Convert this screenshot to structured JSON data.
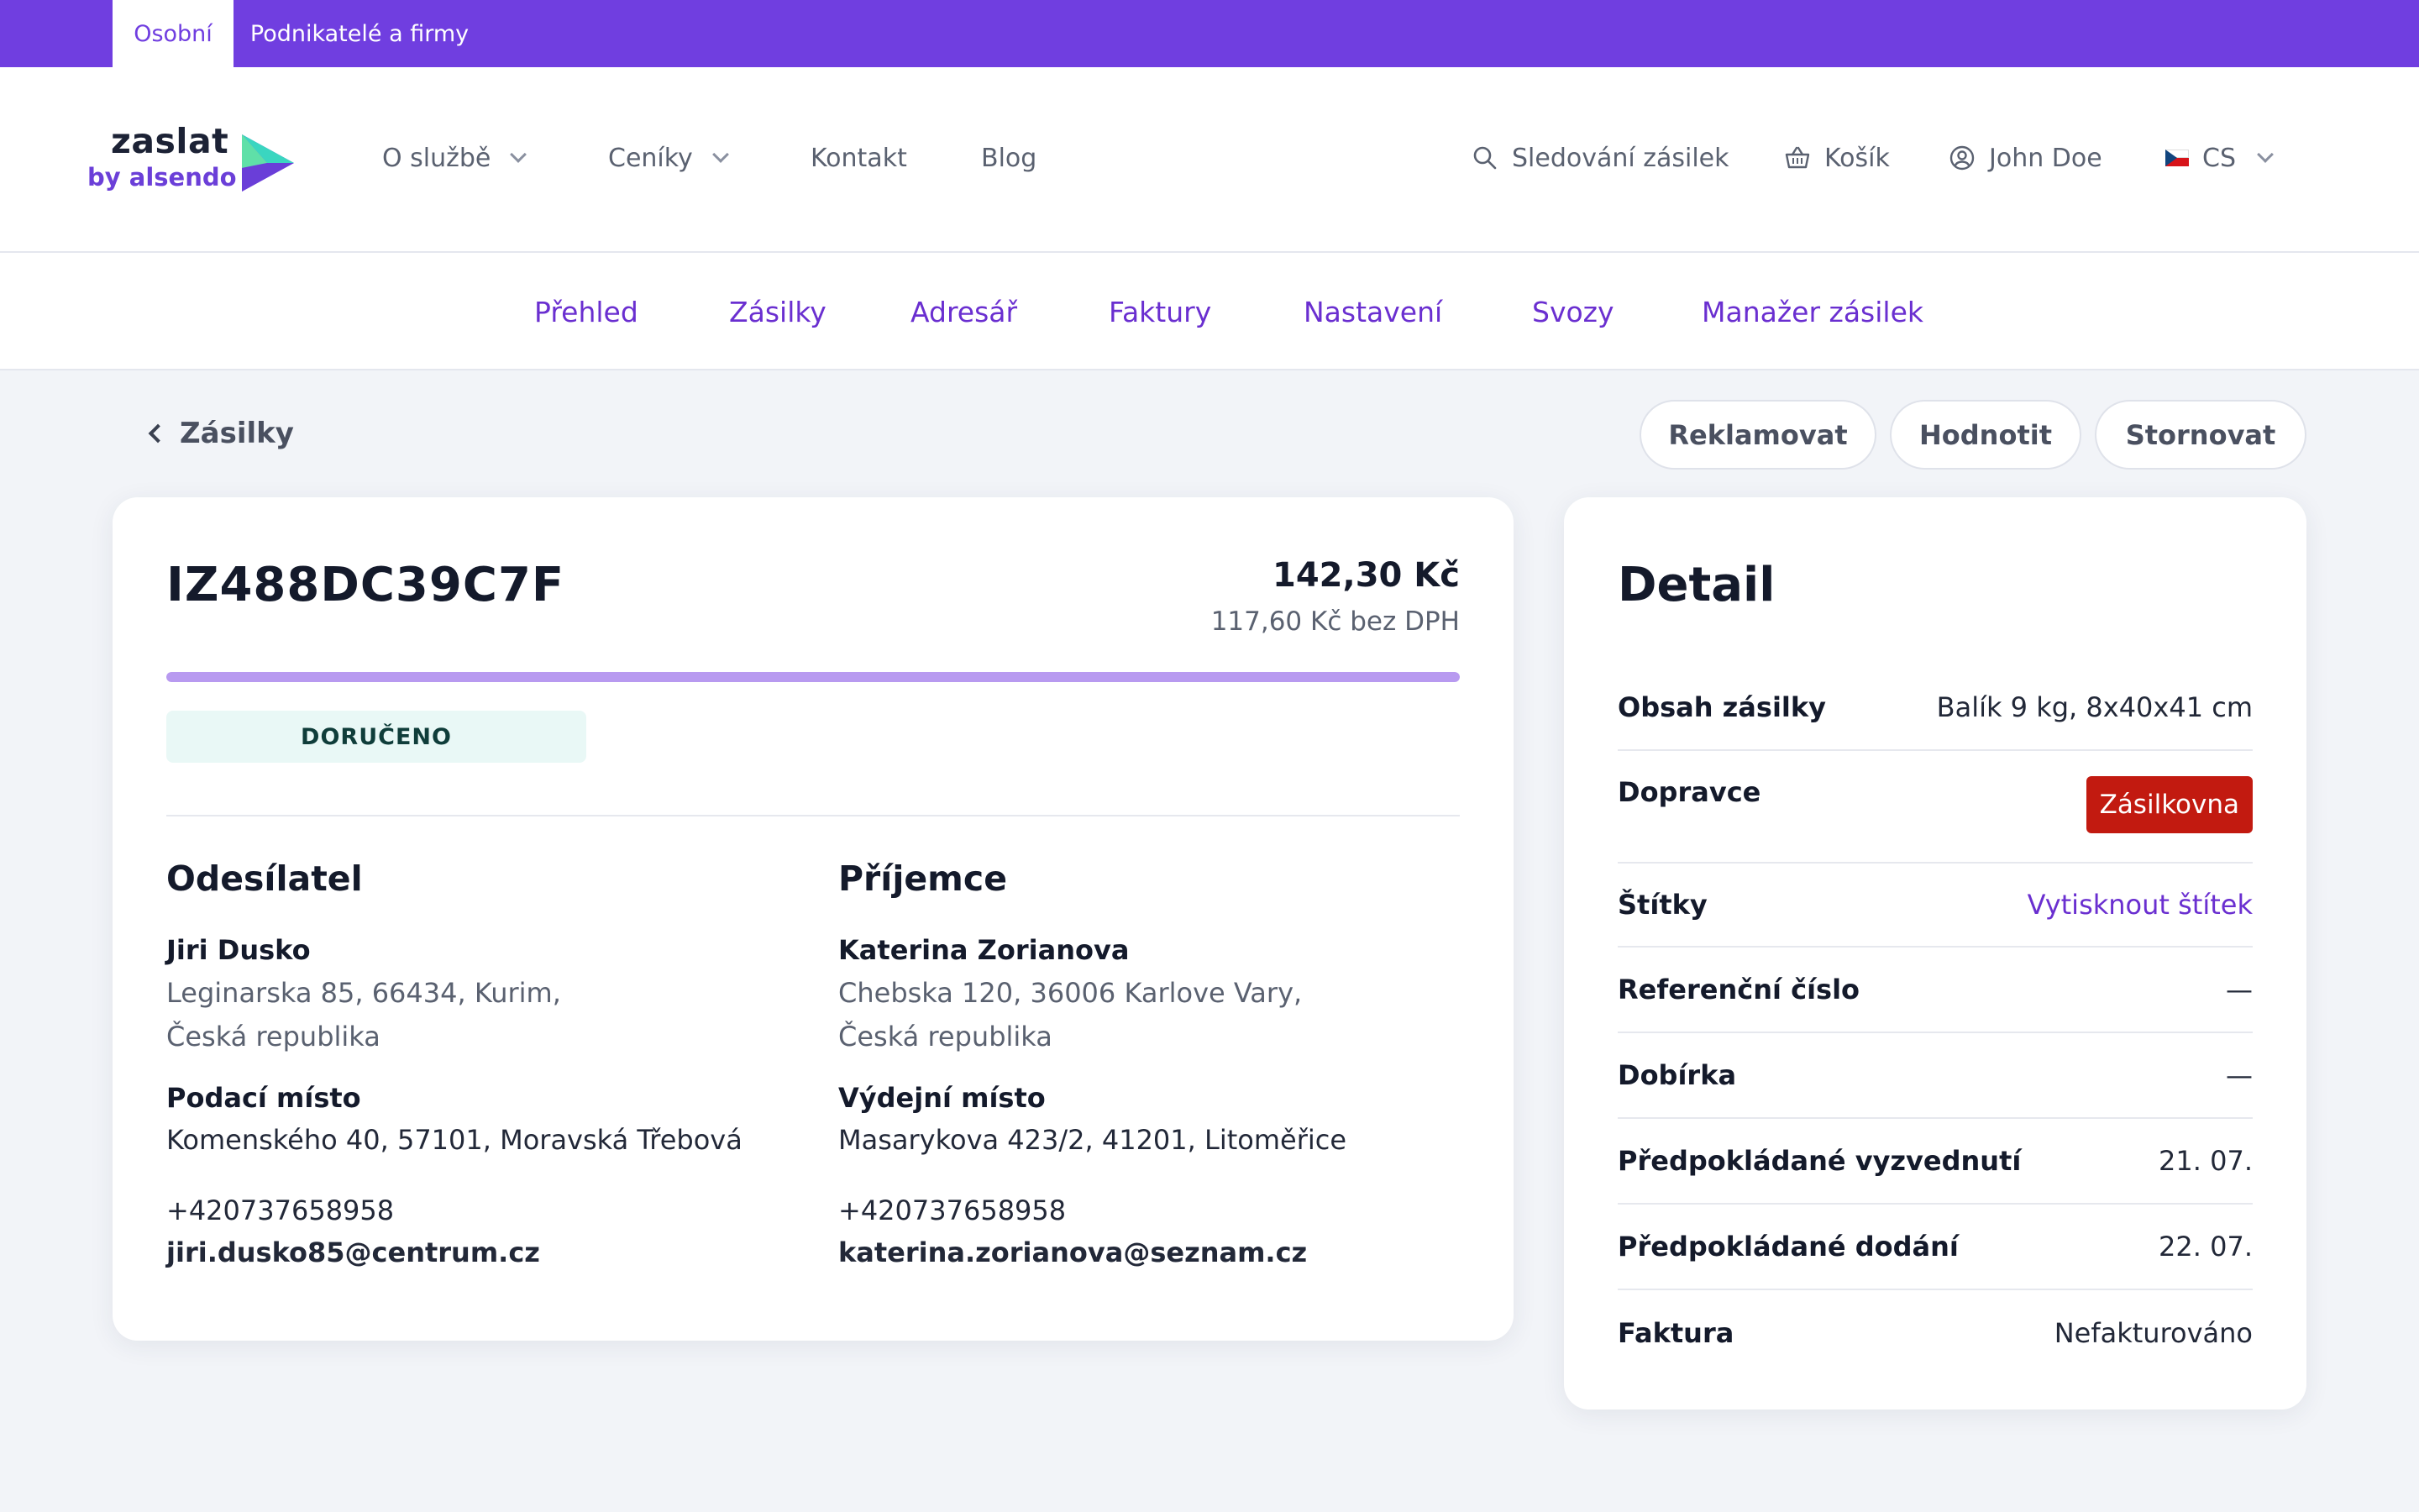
{
  "topbar": {
    "tabs": [
      {
        "label": "Osobní"
      },
      {
        "label": "Podnikatelé a firmy"
      }
    ]
  },
  "logo": {
    "word": "zaslat",
    "sub": "by alsendo"
  },
  "nav": {
    "items": [
      {
        "label": "O službě"
      },
      {
        "label": "Ceníky"
      },
      {
        "label": "Kontakt"
      },
      {
        "label": "Blog"
      }
    ]
  },
  "utility": {
    "tracking": "Sledování zásilek",
    "cart": "Košík",
    "user": "John Doe",
    "lang": "CS"
  },
  "subnav": {
    "tabs": [
      {
        "label": "Přehled"
      },
      {
        "label": "Zásilky"
      },
      {
        "label": "Adresář"
      },
      {
        "label": "Faktury"
      },
      {
        "label": "Nastavení"
      },
      {
        "label": "Svozy"
      },
      {
        "label": "Manažer zásilek"
      }
    ]
  },
  "toolbar": {
    "back_label": "Zásilky",
    "claim": "Reklamovat",
    "rate": "Hodnotit",
    "cancel": "Stornovat"
  },
  "shipment": {
    "tracking_number": "IZ488DC39C7F",
    "price": "142,30 Kč",
    "price_net": "117,60 Kč bez DPH",
    "progress": 1.0,
    "status": "DORUČENO"
  },
  "sender": {
    "heading": "Odesílatel",
    "name": "Jiri Dusko",
    "address_line1": "Leginarska 85, 66434, Kurim,",
    "address_line2": "Česká republika",
    "place_label": "Podací místo",
    "place": "Komenského 40, 57101, Moravská Třebová",
    "phone": "+420737658958",
    "email": "jiri.dusko85@centrum.cz"
  },
  "recipient": {
    "heading": "Příjemce",
    "name": "Katerina Zorianova",
    "address_line1": "Chebska 120, 36006 Karlove Vary,",
    "address_line2": "Česká republika",
    "place_label": "Výdejní místo",
    "place": "Masarykova 423/2, 41201, Litoměřice",
    "phone": "+420737658958",
    "email": "katerina.zorianova@seznam.cz"
  },
  "detail": {
    "title": "Detail",
    "rows": [
      {
        "key": "Obsah zásilky",
        "value": "Balík 9 kg, 8x40x41 cm"
      },
      {
        "key": "Dopravce",
        "value": "Zásilkovna"
      },
      {
        "key": "Štítky",
        "value": "Vytisknout štítek"
      },
      {
        "key": "Referenční číslo",
        "value": "—"
      },
      {
        "key": "Dobírka",
        "value": "—"
      },
      {
        "key": "Předpokládané vyzvednutí",
        "value": "21. 07."
      },
      {
        "key": "Předpokládané dodání",
        "value": "22. 07."
      },
      {
        "key": "Faktura",
        "value": "Nefakturováno"
      }
    ]
  },
  "colors": {
    "brand": "#703ee0",
    "link": "#6a2fd0",
    "carrier_badge": "#c21a10",
    "status_bg": "#e9f8f6",
    "progress_fill": "#b89af0"
  }
}
